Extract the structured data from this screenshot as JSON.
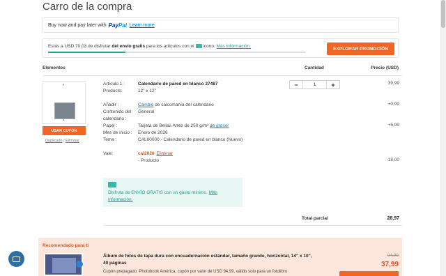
{
  "page": {
    "title": "Carro de la compra"
  },
  "paypal": {
    "text": "Buy now and pay later with",
    "logo_pay": "Pay",
    "logo_pal": "Pal",
    "learn_more": "Learn more"
  },
  "shipping": {
    "text_before": "Estás a USD 70,03 de disfrutar",
    "text_bold": "del envío gratis",
    "text_after": "para los artículos con el",
    "text_after2": "icono.",
    "more_info": "Más información.",
    "progress": 0.3,
    "explore_button": "EXPLORAR PROMOCIÓN"
  },
  "table": {
    "col_elements": "Elementos",
    "col_quantity": "Cantidad",
    "col_price": "Precio (USD)"
  },
  "item": {
    "coupon_button": "USAR CUPÓN",
    "duplicate": "Duplicado",
    "separator": "/",
    "remove": "Eliminar",
    "article_label": "Artículo 1 :",
    "article_name": "Calendario de pared en blanco 27487",
    "product_label": "Producto:",
    "product_value": "12\" x 12\"",
    "article_price": "39,99",
    "quantity": "1",
    "add_label": "Añadir :",
    "add_link": "Cambio",
    "add_value": "de calcomanía del calendario",
    "add_price": "+0,99",
    "content_label": "Contenido del calendario :",
    "content_value": "General",
    "paper_label": "Papel :",
    "paper_value": "Tarjeta de Bellas Artes de 250 g/m²",
    "paper_link": "de grosor",
    "paper_price": "+5,99",
    "start_label": "Mes de inicio :",
    "start_value": "Enero de 2026",
    "theme_label": "Tema :",
    "theme_value": "CAL00000 - Calendario de pared en blanco (Nuevo)",
    "voucher_label": "Vale:",
    "voucher_code": "cal2026",
    "voucher_remove": "Eliminar",
    "voucher_desc": "- Producto",
    "voucher_price": "-18,00"
  },
  "promo": {
    "text": "Disfruta de ENVÍO GRATIS con un gasto mínimo.",
    "more": "Más información."
  },
  "subtotal": {
    "label": "Total parcial",
    "value": "28,97"
  },
  "recommended": {
    "title": "Recomendado para ti",
    "name": "Álbum de fotos de tapa dura con encuadernación estándar, tamaño grande, horizontal, 14\" x 10\", 40 páginas",
    "desc": "Cupón prepagado: Photobook America, cupón por valor de USD 94,99, válido solo para un fotolibro",
    "old_price": "94,99",
    "new_price": "37,99"
  },
  "colors": {
    "accent": "#f26522",
    "teal": "#1fa891",
    "paypal_blue": "#003087"
  }
}
